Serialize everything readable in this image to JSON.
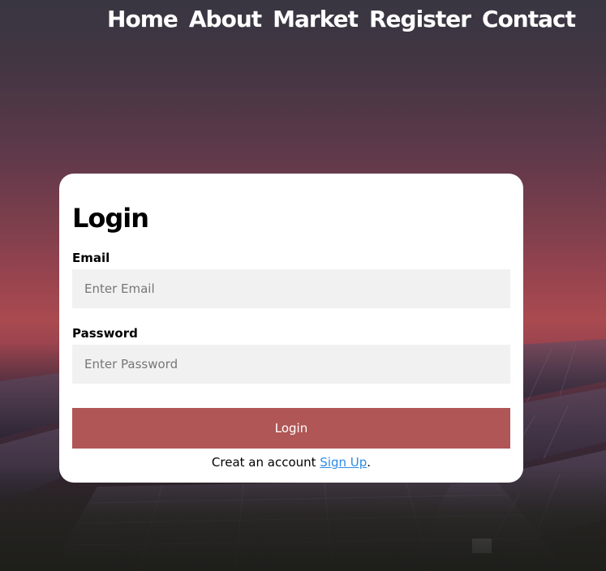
{
  "nav": {
    "items": [
      {
        "label": "Home"
      },
      {
        "label": "About"
      },
      {
        "label": "Market"
      },
      {
        "label": "Register"
      },
      {
        "label": "Contact"
      }
    ]
  },
  "login": {
    "title": "Login",
    "email_label": "Email",
    "email_placeholder": "Enter Email",
    "email_value": "",
    "password_label": "Password",
    "password_placeholder": "Enter Password",
    "password_value": "",
    "submit_label": "Login",
    "signup_prefix": "Creat an account",
    "signup_link": "Sign Up",
    "signup_suffix": "."
  },
  "colors": {
    "button": "#b05656",
    "link": "#2e8be6",
    "card": "#ffffff",
    "input_bg": "#f1f1f1"
  }
}
